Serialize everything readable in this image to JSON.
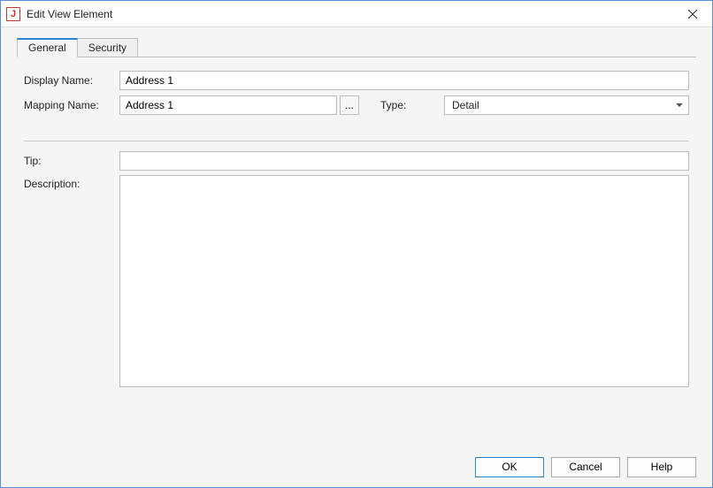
{
  "window": {
    "title": "Edit View Element",
    "app_icon_letter": "J"
  },
  "tabs": {
    "general": "General",
    "security": "Security"
  },
  "labels": {
    "display_name": "Display Name:",
    "mapping_name": "Mapping Name:",
    "type": "Type:",
    "tip": "Tip:",
    "description": "Description:",
    "browse": "..."
  },
  "fields": {
    "display_name": "Address 1",
    "mapping_name": "Address 1",
    "type_selected": "Detail",
    "type_options": [
      "Detail"
    ],
    "tip": "",
    "description": ""
  },
  "buttons": {
    "ok": "OK",
    "cancel": "Cancel",
    "help": "Help"
  }
}
